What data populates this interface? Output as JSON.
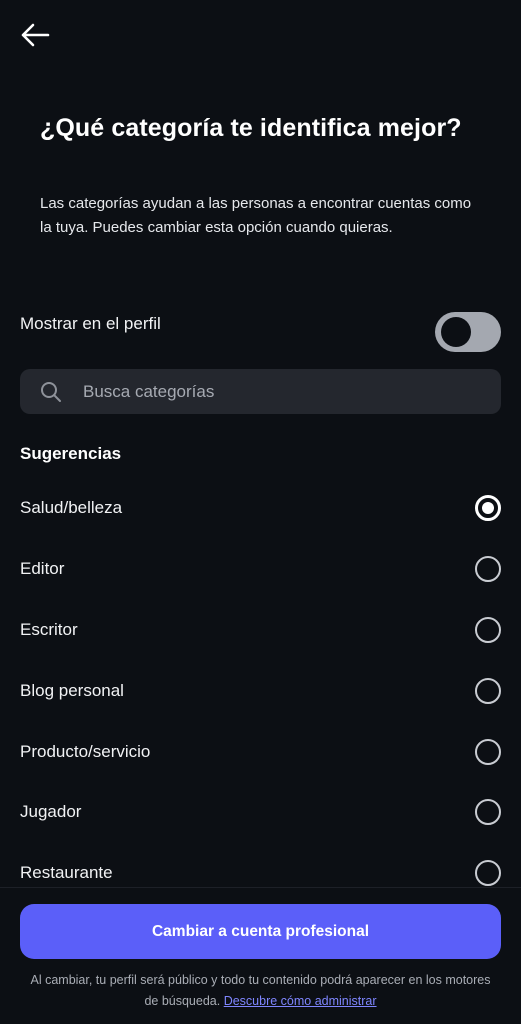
{
  "header": {
    "back_icon": "arrow-left-icon"
  },
  "intro": {
    "title": "¿Qué categoría te identifica mejor?",
    "description": "Las categorías ayudan a las personas a encontrar cuentas como la tuya. Puedes cambiar esta opción cuando quieras."
  },
  "profile_toggle": {
    "label": "Mostrar en el perfil",
    "checked": false
  },
  "search": {
    "icon": "search-icon",
    "placeholder": "Busca categorías",
    "value": ""
  },
  "suggestions": {
    "heading": "Sugerencias",
    "items": [
      {
        "label": "Salud/belleza",
        "selected": true
      },
      {
        "label": "Editor",
        "selected": false
      },
      {
        "label": "Escritor",
        "selected": false
      },
      {
        "label": "Blog personal",
        "selected": false
      },
      {
        "label": "Producto/servicio",
        "selected": false
      },
      {
        "label": "Jugador",
        "selected": false
      },
      {
        "label": "Restaurante",
        "selected": false
      }
    ]
  },
  "footer": {
    "cta_label": "Cambiar a cuenta profesional",
    "notice": "Al cambiar, tu perfil será público y todo tu contenido podrá aparecer en los motores de búsqueda.",
    "link_label": "Descubre cómo administrar"
  },
  "colors": {
    "background": "#0c0f14",
    "accent": "#5b5ff9",
    "link": "#7f86ff",
    "toggle_track_off": "#a4a8b0",
    "search_field": "#24272e"
  }
}
